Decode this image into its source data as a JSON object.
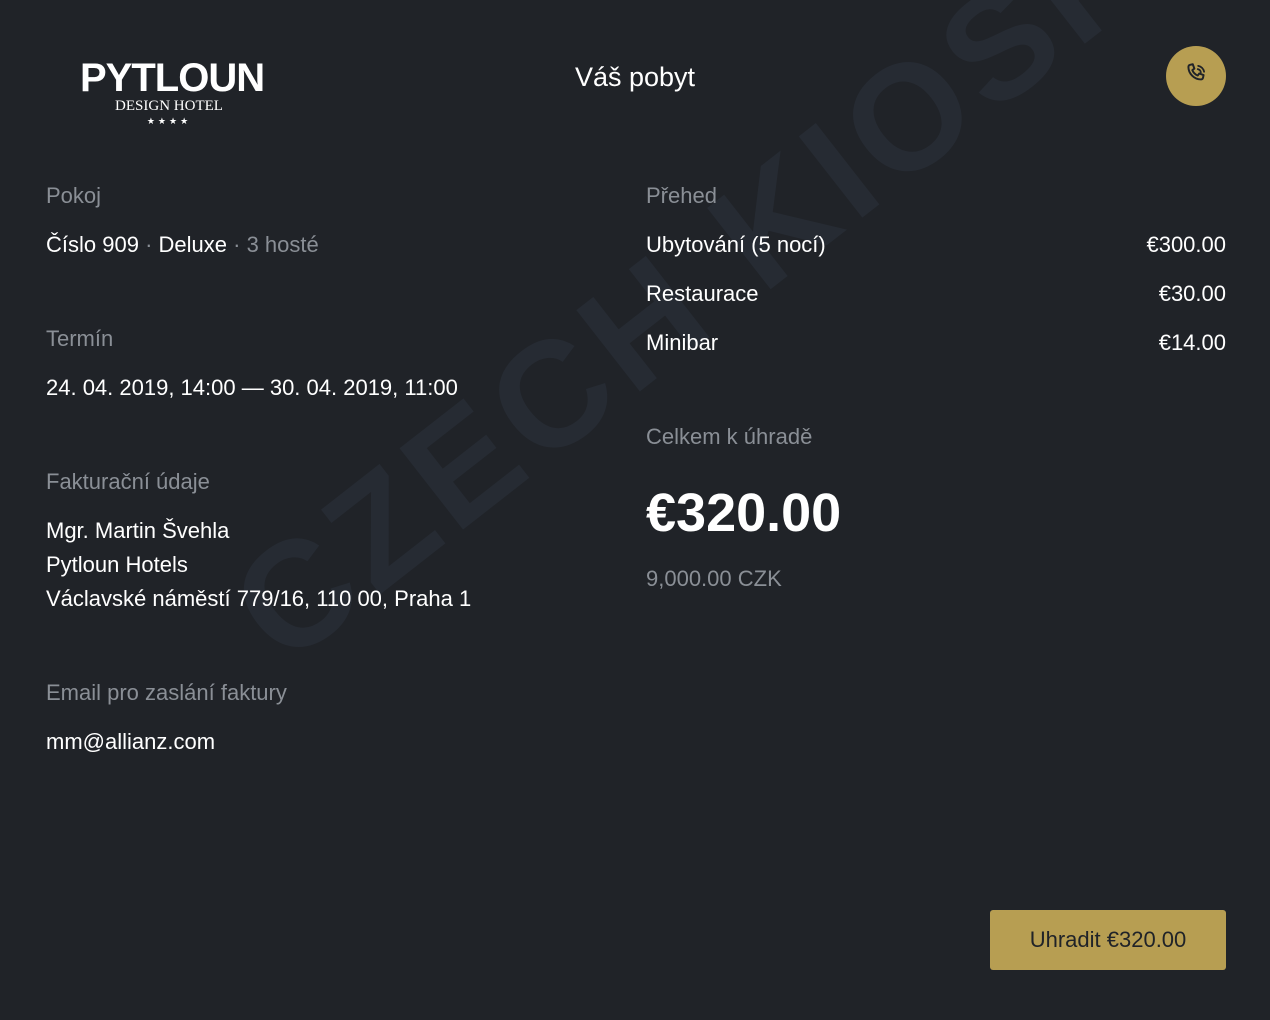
{
  "header": {
    "logo": {
      "name": "PYTLOUN",
      "subtitle": "DESIGN HOTEL",
      "stars": "★★★★"
    },
    "title": "Váš pobyt",
    "call_icon": "phone-icon"
  },
  "watermark": "CZECH KIOSK",
  "room": {
    "label": "Pokoj",
    "number": "Číslo 909",
    "sep1": " · ",
    "type": "Deluxe",
    "sep2": " · ",
    "guests": "3 hosté"
  },
  "term": {
    "label": "Termín",
    "value": "24. 04. 2019, 14:00 — 30. 04. 2019, 11:00"
  },
  "billing": {
    "label": "Fakturační údaje",
    "name": "Mgr. Martin Švehla",
    "company": "Pytloun Hotels",
    "address": "Václavské náměstí 779/16, 110 00, Praha 1"
  },
  "email": {
    "label": "Email pro zaslání faktury",
    "value": "mm@allianz.com"
  },
  "overview": {
    "label": "Přehed",
    "items": [
      {
        "name": "Ubytování (5 nocí)",
        "price": "€300.00"
      },
      {
        "name": "Restaurace",
        "price": "€30.00"
      },
      {
        "name": "Minibar",
        "price": "€14.00"
      }
    ]
  },
  "total": {
    "label": "Celkem k úhradě",
    "amount": "€320.00",
    "czk": "9,000.00 CZK"
  },
  "pay_button": {
    "label": "Uhradit €320.00"
  },
  "colors": {
    "background": "#202328",
    "accent": "#b79e52",
    "muted": "#8a8f96"
  }
}
